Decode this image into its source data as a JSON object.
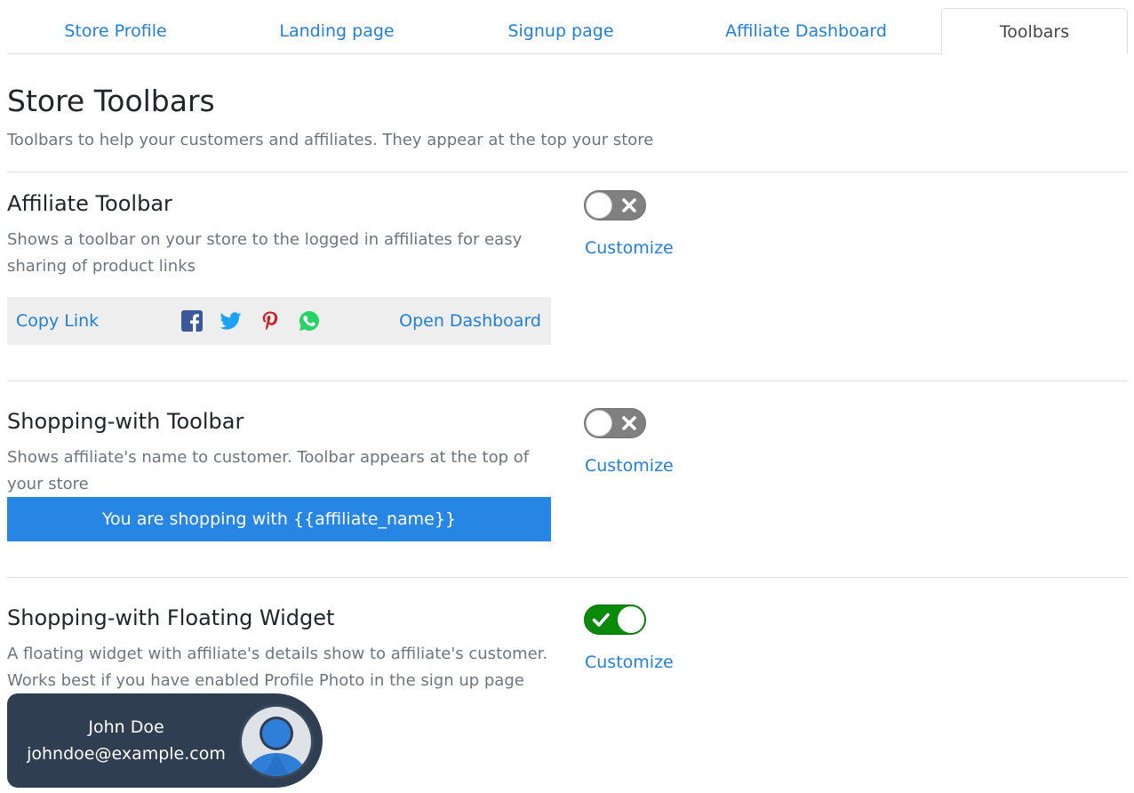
{
  "tabs": [
    {
      "label": "Store Profile"
    },
    {
      "label": "Landing page"
    },
    {
      "label": "Signup page"
    },
    {
      "label": "Affiliate Dashboard"
    },
    {
      "label": "Toolbars",
      "active": true
    }
  ],
  "header": {
    "title": "Store Toolbars",
    "subtitle": "Toolbars to help your customers and affiliates. They appear at the top your store"
  },
  "sections": [
    {
      "title": "Affiliate Toolbar",
      "description": "Shows a toolbar on your store to the logged in affiliates for easy sharing of product links",
      "enabled": false,
      "customize_label": "Customize",
      "preview": {
        "copy_link": "Copy Link",
        "open_dashboard": "Open Dashboard",
        "social_icons": [
          "facebook-icon",
          "twitter-icon",
          "pinterest-icon",
          "whatsapp-icon"
        ]
      }
    },
    {
      "title": "Shopping-with Toolbar",
      "description": "Shows affiliate's name to customer. Toolbar appears at the top of your store",
      "enabled": false,
      "customize_label": "Customize",
      "preview": {
        "text": "You are shopping with {{affiliate_name}}"
      }
    },
    {
      "title": "Shopping-with Floating Widget",
      "description": "A floating widget with affiliate's details show to affiliate's customer. Works best if you have enabled Profile Photo in the sign up page",
      "enabled": true,
      "customize_label": "Customize",
      "preview": {
        "name": "John Doe",
        "email": "johndoe@example.com"
      }
    }
  ],
  "colors": {
    "link": "#1f7fde",
    "toggle_off": "#808080",
    "toggle_on": "#0a8a0a",
    "shop_bar": "#2785e4",
    "widget_bg": "#2f3e51",
    "facebook": "#3b5998",
    "twitter": "#1da1f2",
    "pinterest": "#cb2027",
    "whatsapp": "#25d366"
  }
}
